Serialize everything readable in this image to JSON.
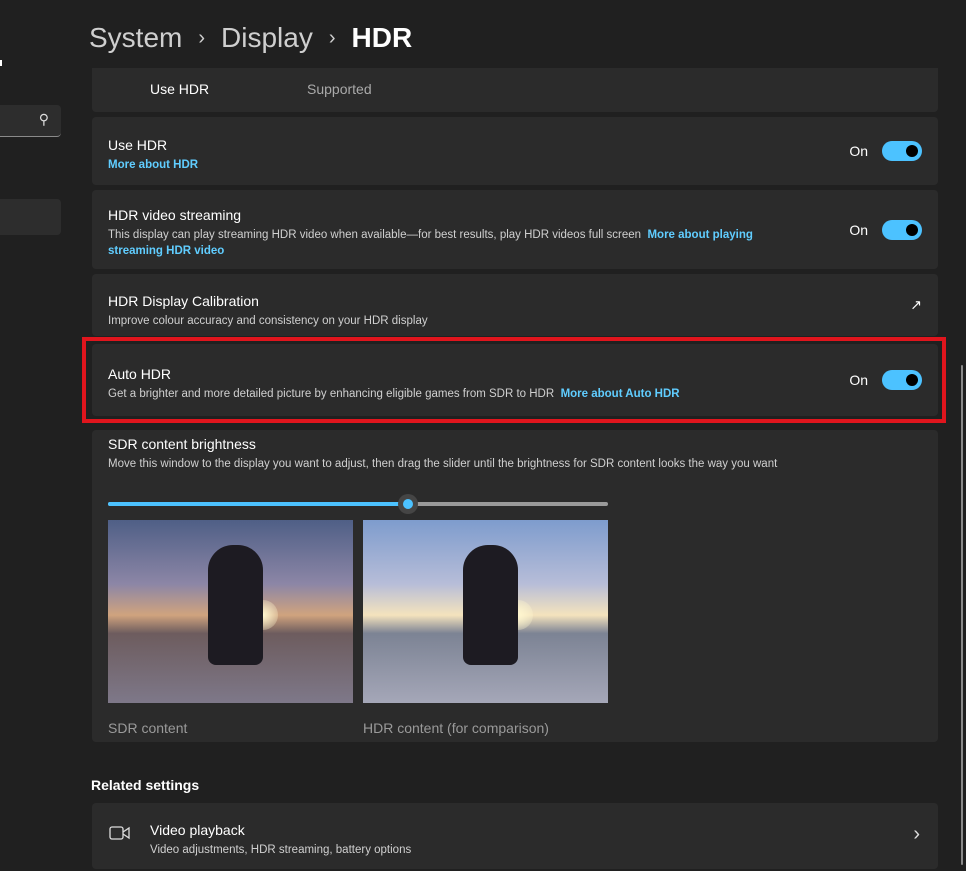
{
  "breadcrumb": {
    "items": [
      "System",
      "Display"
    ],
    "current": "HDR"
  },
  "top_row": {
    "label": "Use HDR",
    "value": "Supported"
  },
  "settings": [
    {
      "title": "Use HDR",
      "link": "More about HDR",
      "state": "On"
    },
    {
      "title": "HDR video streaming",
      "desc": "This display can play streaming HDR video when available—for best results, play HDR videos full screen",
      "link": "More about playing streaming HDR video",
      "state": "On"
    },
    {
      "title": "HDR Display Calibration",
      "desc": "Improve colour accuracy and consistency on your HDR display",
      "icon": "open-external-icon"
    },
    {
      "title": "Auto HDR",
      "desc": "Get a brighter and more detailed picture by enhancing eligible games from SDR to HDR",
      "link": "More about Auto HDR",
      "state": "On"
    }
  ],
  "sdr": {
    "title": "SDR content brightness",
    "desc": "Move this window to the display you want to adjust, then drag the slider until the brightness for SDR content looks the way you want",
    "slider_percent": 60,
    "sdr_caption": "SDR content",
    "hdr_caption": "HDR content (for comparison)"
  },
  "related": {
    "heading": "Related settings",
    "items": [
      {
        "title": "Video playback",
        "desc": "Video adjustments, HDR streaming, battery options",
        "icon": "video-camera-icon"
      }
    ]
  },
  "colors": {
    "accent": "#4cc2ff",
    "highlight": "#e0151d"
  }
}
